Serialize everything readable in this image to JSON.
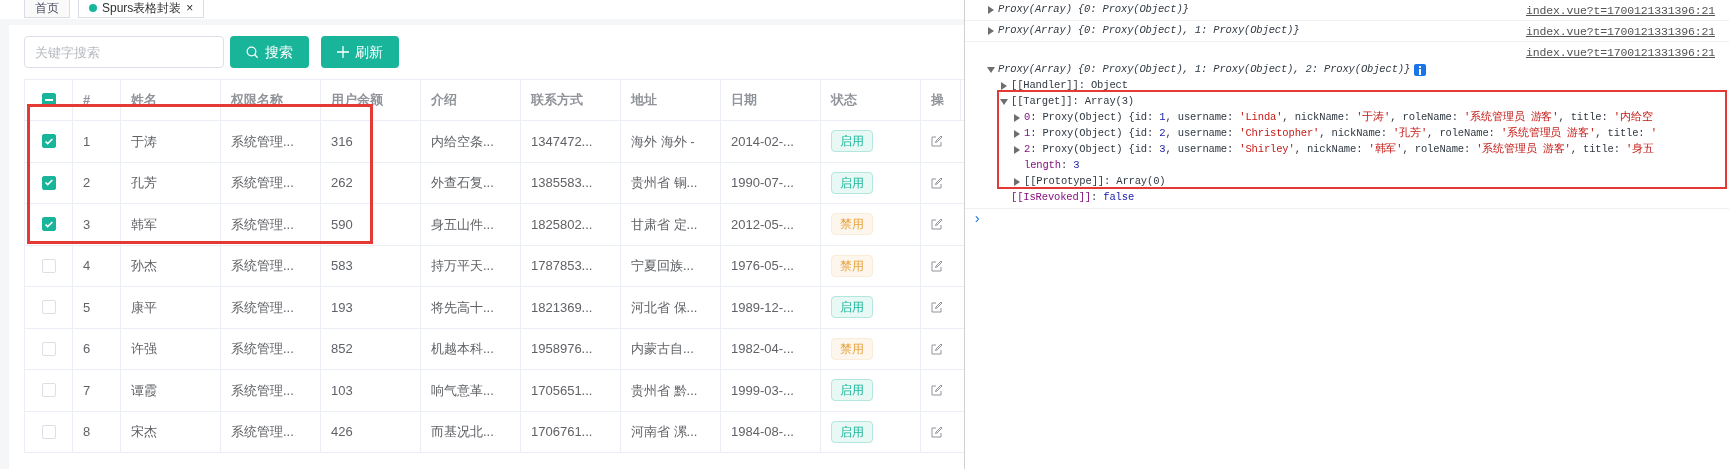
{
  "tabs": [
    {
      "label": "首页",
      "selected": false,
      "dot": false,
      "closable": false
    },
    {
      "label": "Spurs表格封装",
      "selected": true,
      "dot": true,
      "closable": true,
      "close": "×"
    }
  ],
  "search": {
    "placeholder": "关键字搜索"
  },
  "buttons": [
    {
      "kind": "search",
      "label": "搜索"
    },
    {
      "kind": "add",
      "label": "刷新"
    }
  ],
  "table": {
    "partially_checked": true,
    "columns": [
      "#",
      "姓名",
      "权限名称",
      "用户余额",
      "介绍",
      "联系方式",
      "地址",
      "日期",
      "状态",
      "操"
    ],
    "rows": [
      {
        "selected": true,
        "cells": [
          "1",
          "于涛",
          "系统管理...",
          "316",
          "内给空条...",
          "1347472...",
          "海外 海外 -",
          "2014-02-..."
        ],
        "status": {
          "text": "启用",
          "enabled": true
        }
      },
      {
        "selected": true,
        "cells": [
          "2",
          "孔芳",
          "系统管理...",
          "262",
          "外查石复...",
          "1385583...",
          "贵州省 铜...",
          "1990-07-..."
        ],
        "status": {
          "text": "启用",
          "enabled": true
        }
      },
      {
        "selected": true,
        "cells": [
          "3",
          "韩军",
          "系统管理...",
          "590",
          "身五山件...",
          "1825802...",
          "甘肃省 定...",
          "2012-05-..."
        ],
        "status": {
          "text": "禁用",
          "enabled": false
        }
      },
      {
        "selected": false,
        "cells": [
          "4",
          "孙杰",
          "系统管理...",
          "583",
          "持万平天...",
          "1787853...",
          "宁夏回族...",
          "1976-05-..."
        ],
        "status": {
          "text": "禁用",
          "enabled": false
        }
      },
      {
        "selected": false,
        "cells": [
          "5",
          "康平",
          "系统管理...",
          "193",
          "将先高十...",
          "1821369...",
          "河北省 保...",
          "1989-12-..."
        ],
        "status": {
          "text": "启用",
          "enabled": true
        }
      },
      {
        "selected": false,
        "cells": [
          "6",
          "许强",
          "系统管理...",
          "852",
          "机越本科...",
          "1958976...",
          "内蒙古自...",
          "1982-04-..."
        ],
        "status": {
          "text": "禁用",
          "enabled": false
        }
      },
      {
        "selected": false,
        "cells": [
          "7",
          "谭霞",
          "系统管理...",
          "103",
          "响气意革...",
          "1705651...",
          "贵州省 黔...",
          "1999-03-..."
        ],
        "status": {
          "text": "启用",
          "enabled": true
        }
      },
      {
        "selected": false,
        "cells": [
          "8",
          "宋杰",
          "系统管理...",
          "426",
          "而基况北...",
          "1706761...",
          "河南省 漯...",
          "1984-08-..."
        ],
        "status": {
          "text": "启用",
          "enabled": true
        }
      }
    ]
  },
  "console": {
    "messages": [
      {
        "expanded": false,
        "info": false,
        "source": "index.vue?t=1700121331396:21",
        "segments": [
          {
            "t": "Proxy(Array) {0: Proxy(Object)}",
            "kind": "plain"
          }
        ]
      },
      {
        "expanded": false,
        "info": false,
        "source": "index.vue?t=1700121331396:21",
        "segments": [
          {
            "t": "Proxy(Array) {0: Proxy(Object), 1: Proxy(Object)}",
            "kind": "plain"
          }
        ]
      },
      {
        "expanded": true,
        "info": true,
        "source": "index.vue?t=1700121331396:21",
        "segments": [
          {
            "t": "Proxy(Array) {0: Proxy(Object), 1: Proxy(Object), 2: Proxy(Object)}",
            "kind": "plain"
          }
        ],
        "children": [
          {
            "expanded": false,
            "segments": [
              {
                "t": "[[Handler]]",
                "kind": "plain"
              },
              {
                "t": ": Object",
                "kind": "plain"
              }
            ]
          },
          {
            "expanded": true,
            "segments": [
              {
                "t": "[[Target]]",
                "kind": "plain"
              },
              {
                "t": ": Array(3)",
                "kind": "plain"
              }
            ],
            "children": [
              {
                "expanded": false,
                "segments": [
                  {
                    "t": "0",
                    "kind": "key"
                  },
                  {
                    "t": ": Proxy(Object) {id: ",
                    "kind": "plain"
                  },
                  {
                    "t": "1",
                    "kind": "number"
                  },
                  {
                    "t": ", username: ",
                    "kind": "plain"
                  },
                  {
                    "t": "'Linda'",
                    "kind": "string"
                  },
                  {
                    "t": ", nickName: ",
                    "kind": "plain"
                  },
                  {
                    "t": "'于涛'",
                    "kind": "string"
                  },
                  {
                    "t": ", roleName: ",
                    "kind": "plain"
                  },
                  {
                    "t": "'系统管理员 游客'",
                    "kind": "string"
                  },
                  {
                    "t": ", title: ",
                    "kind": "plain"
                  },
                  {
                    "t": "'内给空",
                    "kind": "string"
                  }
                ]
              },
              {
                "expanded": false,
                "segments": [
                  {
                    "t": "1",
                    "kind": "key"
                  },
                  {
                    "t": ": Proxy(Object) {id: ",
                    "kind": "plain"
                  },
                  {
                    "t": "2",
                    "kind": "number"
                  },
                  {
                    "t": ", username: ",
                    "kind": "plain"
                  },
                  {
                    "t": "'Christopher'",
                    "kind": "string"
                  },
                  {
                    "t": ", nickName: ",
                    "kind": "plain"
                  },
                  {
                    "t": "'孔芳'",
                    "kind": "string"
                  },
                  {
                    "t": ", roleName: ",
                    "kind": "plain"
                  },
                  {
                    "t": "'系统管理员 游客'",
                    "kind": "string"
                  },
                  {
                    "t": ", title: ",
                    "kind": "plain"
                  },
                  {
                    "t": "'",
                    "kind": "string"
                  }
                ]
              },
              {
                "expanded": false,
                "segments": [
                  {
                    "t": "2",
                    "kind": "key"
                  },
                  {
                    "t": ": Proxy(Object) {id: ",
                    "kind": "plain"
                  },
                  {
                    "t": "3",
                    "kind": "number"
                  },
                  {
                    "t": ", username: ",
                    "kind": "plain"
                  },
                  {
                    "t": "'Shirley'",
                    "kind": "string"
                  },
                  {
                    "t": ", nickName: ",
                    "kind": "plain"
                  },
                  {
                    "t": "'韩军'",
                    "kind": "string"
                  },
                  {
                    "t": ", roleName: ",
                    "kind": "plain"
                  },
                  {
                    "t": "'系统管理员 游客'",
                    "kind": "string"
                  },
                  {
                    "t": ", title: ",
                    "kind": "plain"
                  },
                  {
                    "t": "'身五",
                    "kind": "string"
                  }
                ]
              },
              {
                "segments": [
                  {
                    "t": "length",
                    "kind": "key"
                  },
                  {
                    "t": ": ",
                    "kind": "plain"
                  },
                  {
                    "t": "3",
                    "kind": "number"
                  }
                ]
              },
              {
                "expanded": false,
                "segments": [
                  {
                    "t": "[[Prototype]]",
                    "kind": "plain"
                  },
                  {
                    "t": ": Array(0)",
                    "kind": "plain"
                  }
                ]
              }
            ]
          },
          {
            "segments": [
              {
                "t": "[[IsRevoked]]",
                "kind": "key"
              },
              {
                "t": ": ",
                "kind": "plain"
              },
              {
                "t": "false",
                "kind": "number"
              }
            ]
          }
        ]
      }
    ],
    "prompt": "›"
  }
}
